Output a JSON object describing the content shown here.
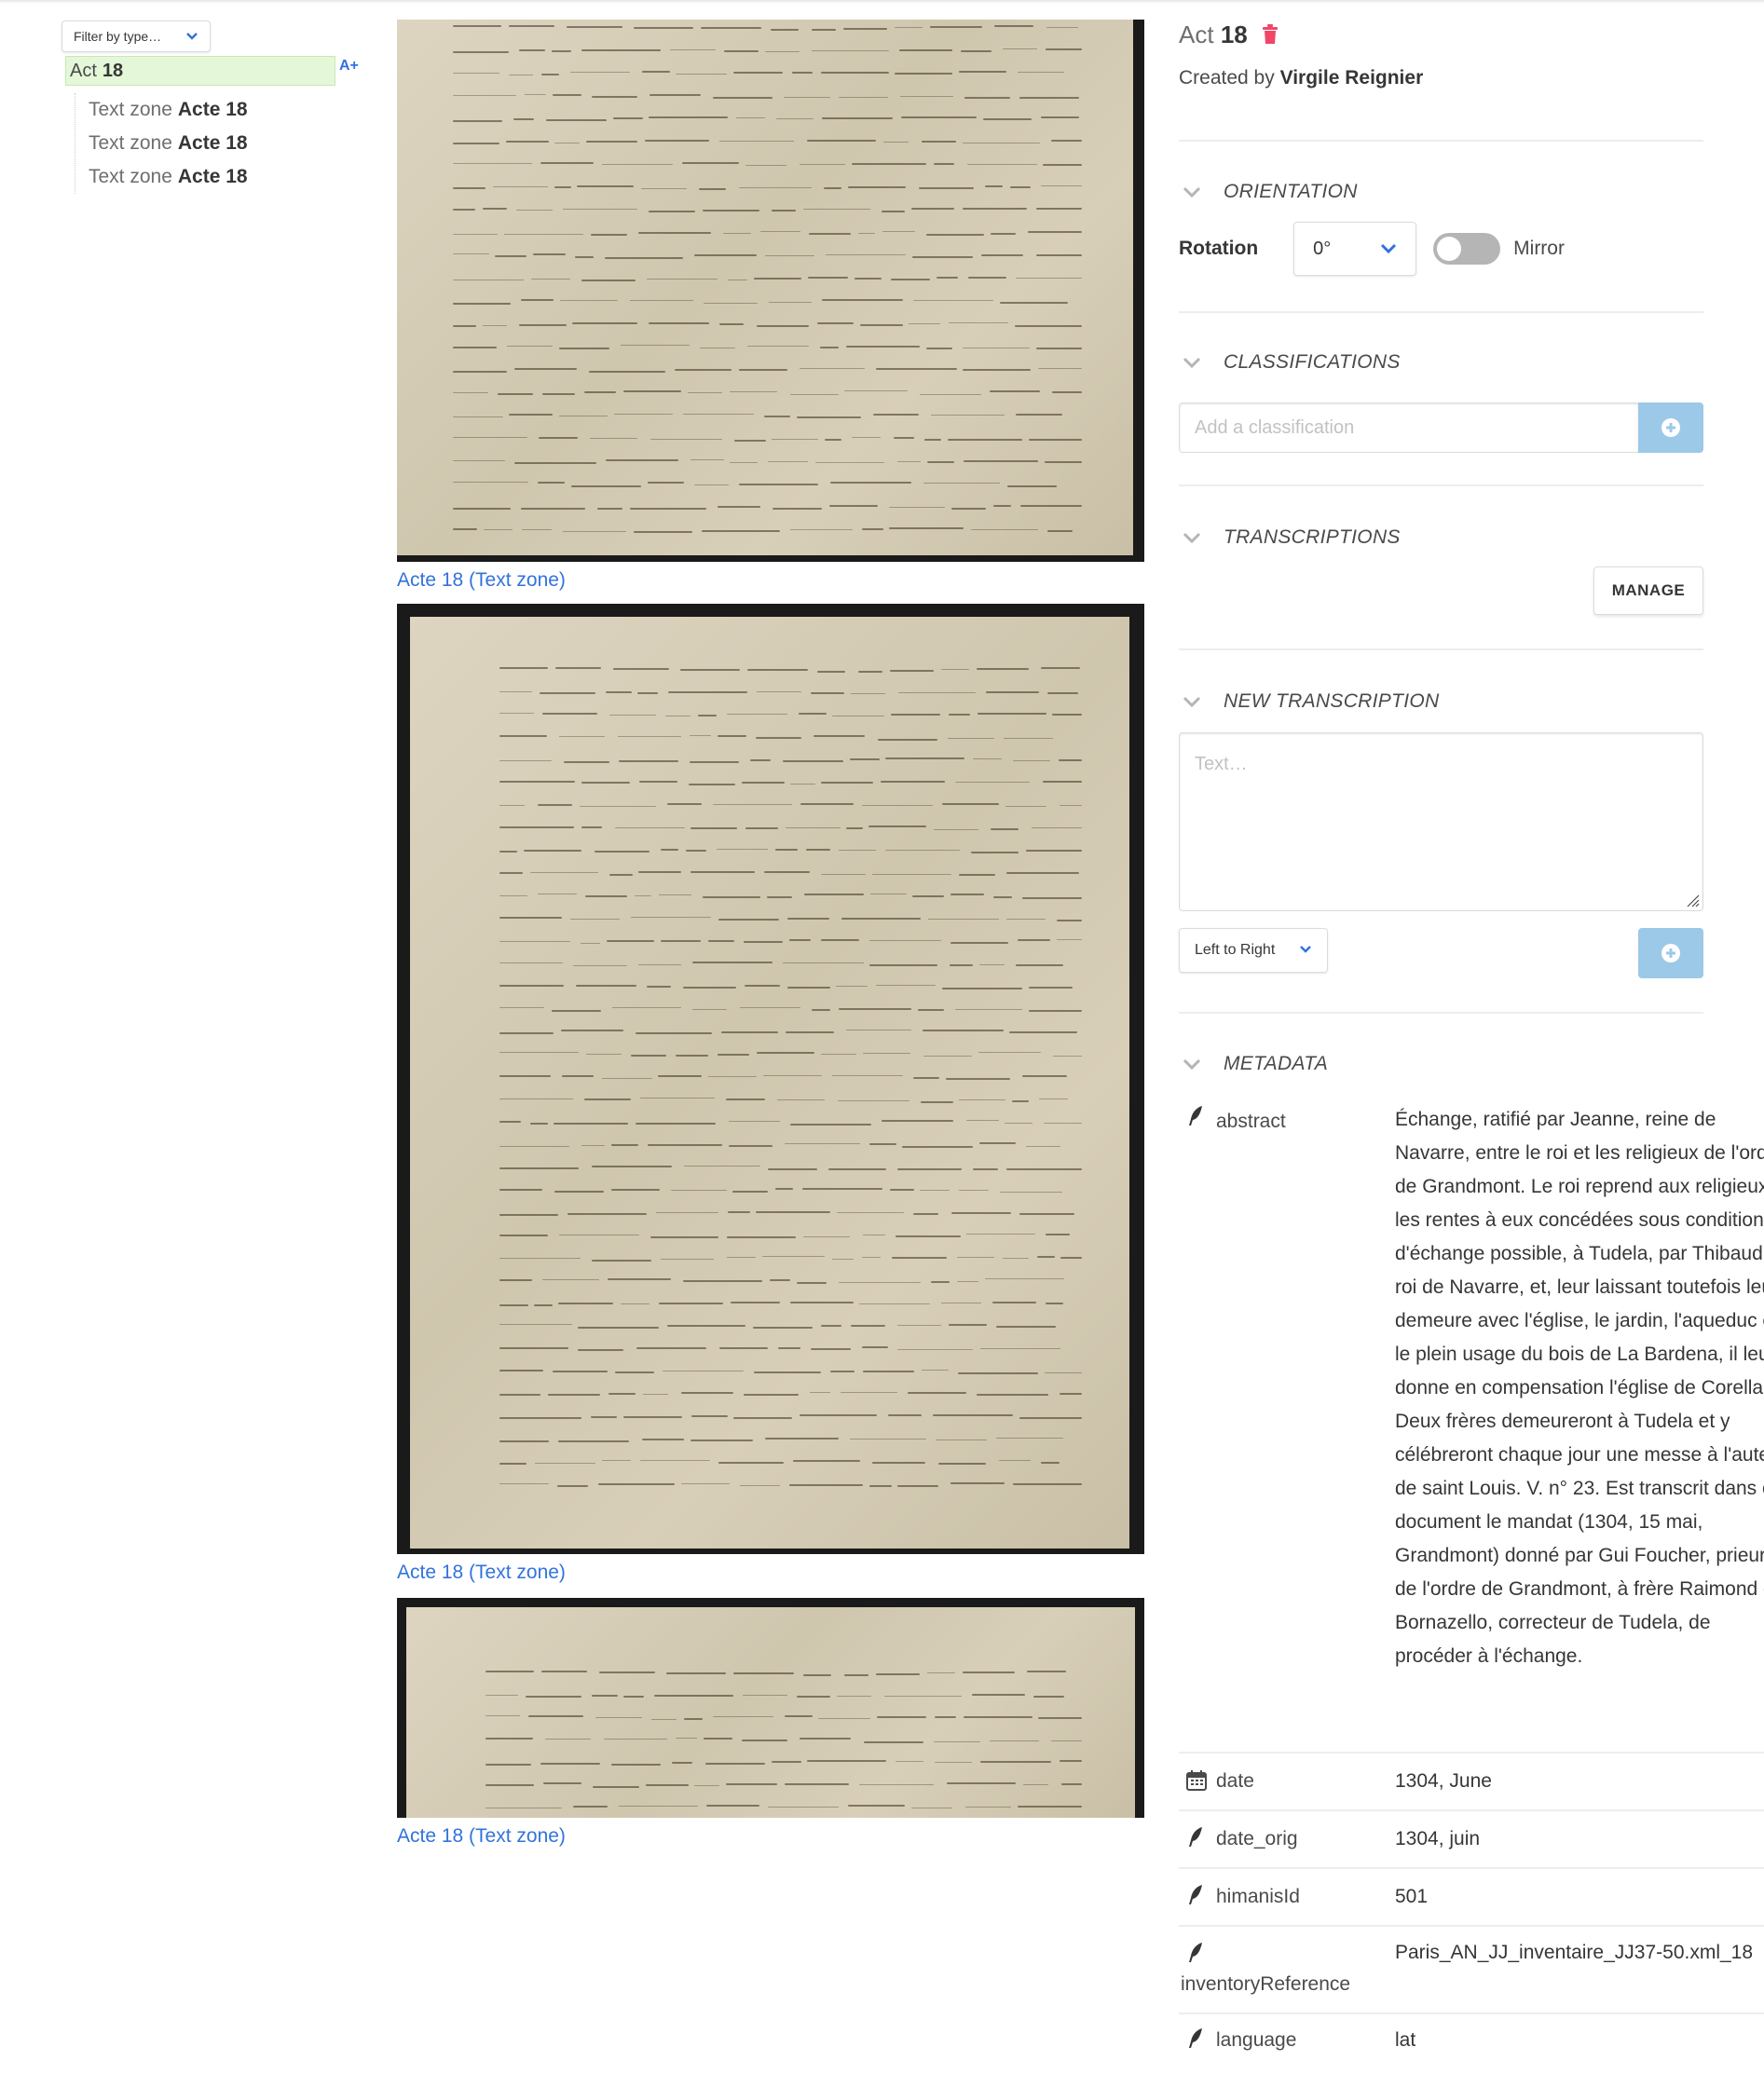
{
  "tree": {
    "filter_label": "Filter by type…",
    "add_label": "A+",
    "root": {
      "type": "Act",
      "name": "18"
    },
    "children": [
      {
        "type": "Text zone",
        "name": "Acte 18"
      },
      {
        "type": "Text zone",
        "name": "Acte 18"
      },
      {
        "type": "Text zone",
        "name": "Acte 18"
      }
    ]
  },
  "zones": [
    {
      "caption": "Acte 18 (Text zone)"
    },
    {
      "caption": "Acte 18 (Text zone)"
    },
    {
      "caption": "Acte 18 (Text zone)"
    }
  ],
  "details": {
    "type": "Act",
    "name": "18",
    "created_prefix": "Created by",
    "creator": "Virgile Reignier",
    "orientation": {
      "heading": "ORIENTATION",
      "rotation_label": "Rotation",
      "rotation_value": "0°",
      "mirror_label": "Mirror",
      "mirror_on": false
    },
    "classifications": {
      "heading": "CLASSIFICATIONS",
      "placeholder": "Add a classification"
    },
    "transcriptions": {
      "heading": "TRANSCRIPTIONS",
      "manage_label": "MANAGE"
    },
    "new_transcription": {
      "heading": "NEW TRANSCRIPTION",
      "placeholder": "Text…",
      "direction": "Left to Right"
    },
    "metadata": {
      "heading": "METADATA",
      "entries": [
        {
          "icon": "quill-icon",
          "name": "abstract",
          "value": "Échange, ratifié par Jeanne, reine de Navarre, entre le roi et les religieux de l'ordre de Grandmont. Le roi reprend aux religieux les rentes à eux concédées sous condition d'échange possible, à Tudela, par Thibaud II, roi de Navarre, et, leur laissant toutefois leur demeure avec l'église, le jardin, l'aqueduc et le plein usage du bois de La Bardena, il leur donne en compensation l'église de Corella. Deux frères demeureront à Tudela et y célébreront chaque jour une messe à l'autel de saint Louis. V. n° 23. Est transcrit dans ce document le mandat (1304, 15 mai, Grandmont) donné par Gui Foucher, prieur de l'ordre de Grandmont, à frère Raimond de Bornazello, correcteur de Tudela, de procéder à l'échange."
        },
        {
          "icon": "calendar-icon",
          "name": "date",
          "value": "1304, June"
        },
        {
          "icon": "quill-icon",
          "name": "date_orig",
          "value": "1304, juin"
        },
        {
          "icon": "quill-icon",
          "name": "himanisId",
          "value": "501"
        },
        {
          "icon": "quill-icon",
          "name": "inventoryReference",
          "value": "Paris_AN_JJ_inventaire_JJ37-50.xml_18"
        },
        {
          "icon": "quill-icon",
          "name": "language",
          "value": "lat"
        }
      ]
    }
  },
  "colors": {
    "accent": "#3273dc",
    "selected_bg": "#e4f7d8",
    "danger": "#f14668",
    "button_disabled": "#9cc9e8"
  }
}
